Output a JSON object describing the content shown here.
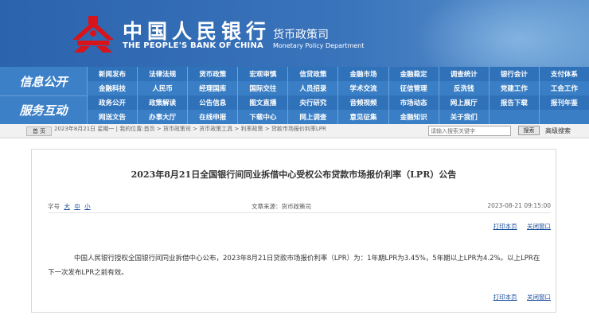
{
  "header": {
    "bank_name_cn": "中国人民银行",
    "bank_name_en": "THE PEOPLE'S BANK OF CHINA",
    "dept_cn": "货币政策司",
    "dept_en": "Monetary Policy Department",
    "emblem": "pboc-emblem-icon"
  },
  "nav": {
    "groups": [
      "信息公开",
      "服务互动"
    ],
    "rows": [
      [
        "新闻发布",
        "法律法规",
        "货币政策",
        "宏观审慎",
        "信贷政策",
        "金融市场",
        "金融稳定",
        "调查统计",
        "银行会计",
        "支付体系"
      ],
      [
        "金融科技",
        "人民币",
        "经理国库",
        "国际交往",
        "人员招录",
        "学术交流",
        "征信管理",
        "反洗钱",
        "党建工作",
        "工会工作"
      ],
      [
        "政务公开",
        "政策解读",
        "公告信息",
        "图文直播",
        "央行研究",
        "音频视频",
        "市场动态",
        "网上展厅",
        "报告下载",
        "报刊年鉴"
      ],
      [
        "网送文告",
        "办事大厅",
        "在线申报",
        "下载中心",
        "网上调查",
        "意见征集",
        "金融知识",
        "关于我们",
        "",
        ""
      ]
    ]
  },
  "crumb": {
    "home_label": "首 页",
    "text": "2023年8月21日 星期一 | 我的位置:首页 > 货币政策司 > 货币政策工具 > 利率政策 > 贷款市场报价利率LPR",
    "search_placeholder": "请输入搜索关键字",
    "search_button": "搜索",
    "advanced_search": "高级搜索"
  },
  "article": {
    "title": "2023年8月21日全国银行间同业拆借中心受权公布贷款市场报价利率（LPR）公告",
    "font_label": "字号",
    "font_large": "大",
    "font_medium": "中",
    "font_small": "小",
    "source": "文章来源：货币政策司",
    "date": "2023-08-21 09:15:00",
    "print": "打印本页",
    "close": "关闭窗口",
    "body": "中国人民银行授权全国银行间同业拆借中心公布，2023年8月21日贷款市场报价利率（LPR）为：1年期LPR为3.45%，5年期以上LPR为4.2%。以上LPR在下一次发布LPR之前有效。"
  }
}
